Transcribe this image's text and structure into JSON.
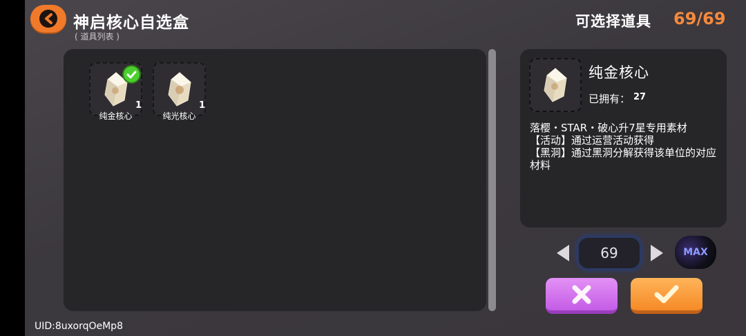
{
  "header": {
    "title": "神启核心自选盒",
    "subtitle": "( 道具列表 )",
    "count_label": "可选择道具",
    "count_value": "69/69"
  },
  "items": [
    {
      "name": "纯金核心",
      "qty": "1",
      "selected": true
    },
    {
      "name": "纯光核心",
      "qty": "1",
      "selected": false
    }
  ],
  "detail": {
    "name": "纯金核心",
    "owned_label": "已拥有：",
    "owned_value": "27",
    "description": "落樱・STAR・破心升7星专用素材\n【活动】通过运营活动获得\n【黑洞】通过黑洞分解获得该单位的对应材料"
  },
  "stepper": {
    "value": "69",
    "max_label": "MAX"
  },
  "footer": {
    "uid": "UID:8uxorqOeMp8"
  },
  "colors": {
    "accent": "#f07a2a",
    "count": "#f58a3c",
    "selected_check": "#4ccf2e",
    "cancel": "#d271ee",
    "confirm": "#f89c3c"
  },
  "icons": {
    "back": "back-arrow-icon",
    "check": "checkmark-icon",
    "crystal": "crystal-icon",
    "cancel": "close-icon"
  }
}
